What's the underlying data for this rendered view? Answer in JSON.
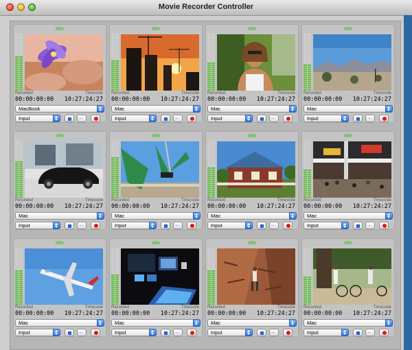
{
  "window": {
    "title": "Movie Recorder Controller"
  },
  "labels": {
    "recorded": "Recorded",
    "timecode": "Timecode",
    "more_glyph": "..."
  },
  "colors": {
    "status_green": "#4dc23a",
    "meter_green": "#5fc23a",
    "meter_orange": "#e8a23a",
    "select_blue": "#2f74d8",
    "record_red": "#e01a12"
  },
  "icons": [
    "stop-icon",
    "more-icon",
    "record-icon",
    "chevron-updown-icon"
  ],
  "panels": [
    {
      "status": "Idle",
      "recorded": "00:00:00:00",
      "timecode": "10:27:24:27",
      "source": "MacBook",
      "input": "Input",
      "level": 0.6,
      "scene": "flower"
    },
    {
      "status": "Idle",
      "recorded": "00:00:00:00",
      "timecode": "10:27:24:27",
      "source": "Mac",
      "input": "Input",
      "level": 0.55,
      "scene": "sunset"
    },
    {
      "status": "Idle",
      "recorded": "00:00:00:00",
      "timecode": "10:27:24:27",
      "source": "Mac",
      "input": "Input",
      "level": 0.5,
      "scene": "woman"
    },
    {
      "status": "Idle",
      "recorded": "00:00:00:00",
      "timecode": "10:27:24:27",
      "source": "Mac",
      "input": "Input",
      "level": 0.45,
      "scene": "desert"
    },
    {
      "status": "Idle",
      "recorded": "00:00:00:00",
      "timecode": "10:27:24:27",
      "source": "Mac",
      "input": "Input",
      "level": 0.65,
      "scene": "car"
    },
    {
      "status": "Idle",
      "recorded": "00:00:00:00",
      "timecode": "10:27:24:27",
      "source": "Mac",
      "input": "Input",
      "level": 0.7,
      "scene": "ride"
    },
    {
      "status": "Idle",
      "recorded": "00:00:00:00",
      "timecode": "10:27:24:27",
      "source": "Mac",
      "input": "Input",
      "level": 0.55,
      "scene": "house"
    },
    {
      "status": "Idle",
      "recorded": "00:00:00:00",
      "timecode": "10:27:24:27",
      "source": "Mac",
      "input": "Input",
      "level": 0.5,
      "scene": "expo"
    },
    {
      "status": "Idle",
      "recorded": "00:00:00:00",
      "timecode": "10:27:24:27",
      "source": "Mac",
      "input": "Input",
      "level": 0.6,
      "scene": "plane"
    },
    {
      "status": "Idle",
      "recorded": "00:00:00:00",
      "timecode": "10:27:24:27",
      "source": "Mac",
      "input": "Input",
      "level": 0.55,
      "scene": "studio"
    },
    {
      "status": "Idle",
      "recorded": "00:00:00:00",
      "timecode": "10:27:24:27",
      "source": "Mac",
      "input": "Input",
      "level": 0.6,
      "scene": "climber"
    },
    {
      "status": "Idle",
      "recorded": "00:00:00:00",
      "timecode": "10:27:24:27",
      "source": "Mac",
      "input": "Input",
      "level": 0.5,
      "scene": "bikers"
    }
  ]
}
